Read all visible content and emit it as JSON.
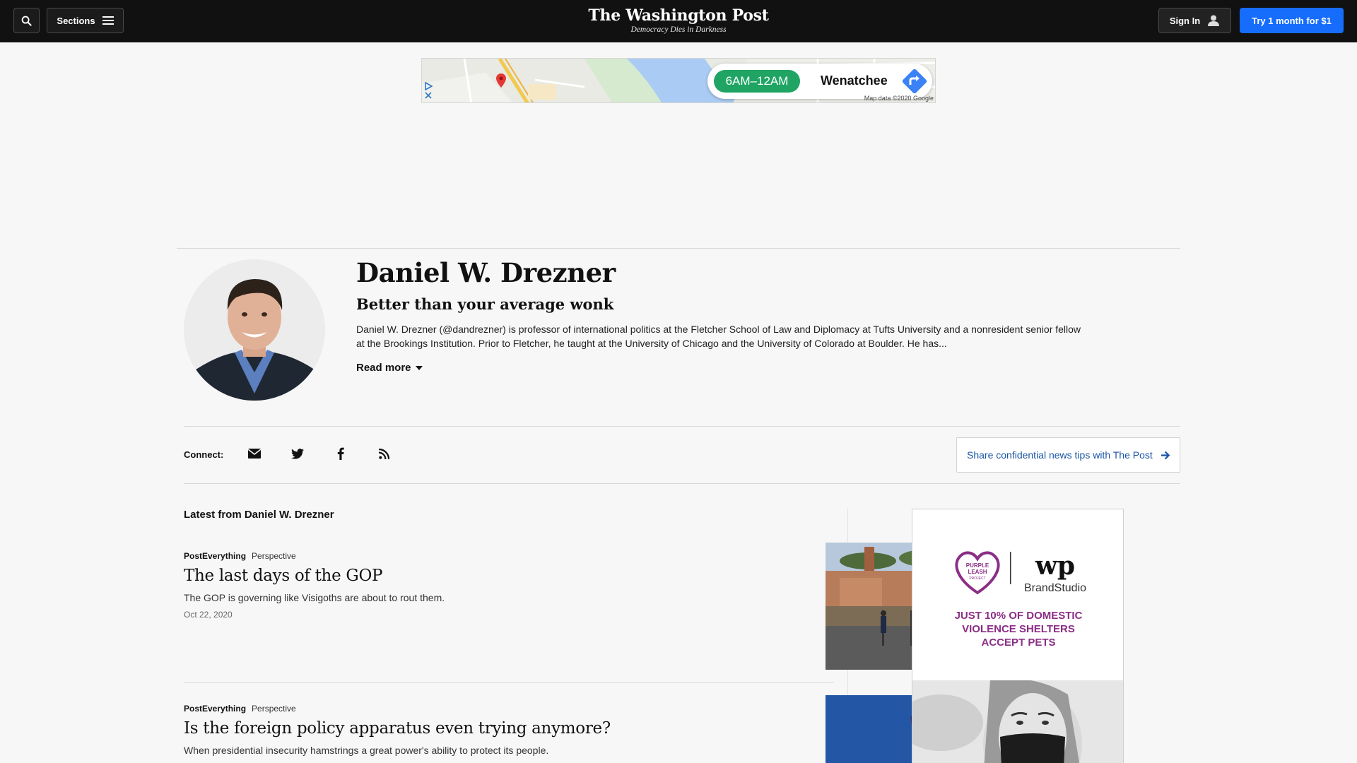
{
  "header": {
    "sections_label": "Sections",
    "brand_name": "The Washington Post",
    "brand_tagline": "Democracy Dies in Darkness",
    "signin_label": "Sign In",
    "subscribe_label": "Try 1 month for $1"
  },
  "top_ad": {
    "hours": "6AM–12AM",
    "city": "Wenatchee",
    "map_credit": "Map data ©2020 Google"
  },
  "author": {
    "name": "Daniel W. Drezner",
    "tagline": "Better than your average wonk",
    "bio": "Daniel W. Drezner (@dandrezner) is professor of international politics at the Fletcher School of Law and Diplomacy at Tufts University and a nonresident senior fellow at the Brookings Institution. Prior to Fletcher, he taught at the University of Chicago and the University of Colorado at Boulder. He has...",
    "read_more": "Read more"
  },
  "connect": {
    "label": "Connect:",
    "icons": [
      "email-icon",
      "twitter-icon",
      "facebook-icon",
      "rss-icon"
    ],
    "tips_label": "Share confidential news tips with The Post"
  },
  "feed": {
    "heading": "Latest from Daniel W. Drezner",
    "stories": [
      {
        "section": "PostEverything",
        "label": "Perspective",
        "title": "The last days of the GOP",
        "blurb": "The GOP is governing like Visigoths are about to rout them.",
        "date": "Oct 22, 2020"
      },
      {
        "section": "PostEverything",
        "label": "Perspective",
        "title": "Is the foreign policy apparatus even trying anymore?",
        "blurb": "When presidential insecurity hamstrings a great power's ability to protect its people."
      }
    ]
  },
  "side_ad": {
    "logo_left": "PURPLE LEASH PROJECT",
    "logo_right_mark": "wp",
    "logo_right_text": "BrandStudio",
    "headline_1": "JUST 10% OF DOMESTIC",
    "headline_2": "VIOLENCE SHELTERS",
    "headline_3": "ACCEPT PETS"
  },
  "colors": {
    "topbar": "#111111",
    "subscribe": "#166dfc",
    "link": "#1955a5",
    "ad_purple": "#8b2e86",
    "hours_green": "#1fa463"
  }
}
